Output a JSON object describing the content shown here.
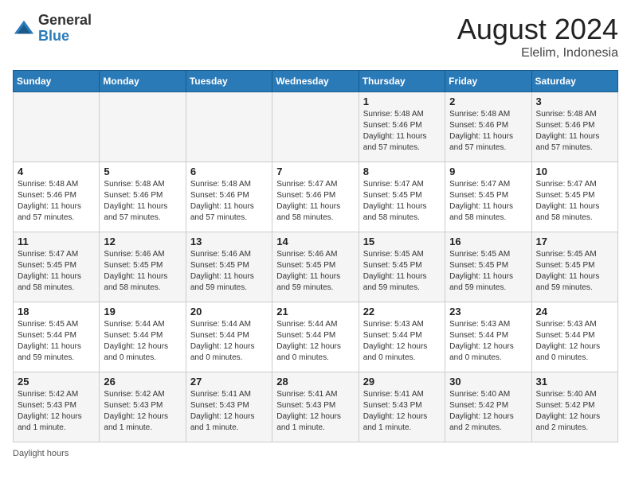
{
  "header": {
    "logo_general": "General",
    "logo_blue": "Blue",
    "month_year": "August 2024",
    "location": "Elelim, Indonesia"
  },
  "days_of_week": [
    "Sunday",
    "Monday",
    "Tuesday",
    "Wednesday",
    "Thursday",
    "Friday",
    "Saturday"
  ],
  "weeks": [
    [
      {
        "day": "",
        "info": ""
      },
      {
        "day": "",
        "info": ""
      },
      {
        "day": "",
        "info": ""
      },
      {
        "day": "",
        "info": ""
      },
      {
        "day": "1",
        "info": "Sunrise: 5:48 AM\nSunset: 5:46 PM\nDaylight: 11 hours\nand 57 minutes."
      },
      {
        "day": "2",
        "info": "Sunrise: 5:48 AM\nSunset: 5:46 PM\nDaylight: 11 hours\nand 57 minutes."
      },
      {
        "day": "3",
        "info": "Sunrise: 5:48 AM\nSunset: 5:46 PM\nDaylight: 11 hours\nand 57 minutes."
      }
    ],
    [
      {
        "day": "4",
        "info": "Sunrise: 5:48 AM\nSunset: 5:46 PM\nDaylight: 11 hours\nand 57 minutes."
      },
      {
        "day": "5",
        "info": "Sunrise: 5:48 AM\nSunset: 5:46 PM\nDaylight: 11 hours\nand 57 minutes."
      },
      {
        "day": "6",
        "info": "Sunrise: 5:48 AM\nSunset: 5:46 PM\nDaylight: 11 hours\nand 57 minutes."
      },
      {
        "day": "7",
        "info": "Sunrise: 5:47 AM\nSunset: 5:46 PM\nDaylight: 11 hours\nand 58 minutes."
      },
      {
        "day": "8",
        "info": "Sunrise: 5:47 AM\nSunset: 5:45 PM\nDaylight: 11 hours\nand 58 minutes."
      },
      {
        "day": "9",
        "info": "Sunrise: 5:47 AM\nSunset: 5:45 PM\nDaylight: 11 hours\nand 58 minutes."
      },
      {
        "day": "10",
        "info": "Sunrise: 5:47 AM\nSunset: 5:45 PM\nDaylight: 11 hours\nand 58 minutes."
      }
    ],
    [
      {
        "day": "11",
        "info": "Sunrise: 5:47 AM\nSunset: 5:45 PM\nDaylight: 11 hours\nand 58 minutes."
      },
      {
        "day": "12",
        "info": "Sunrise: 5:46 AM\nSunset: 5:45 PM\nDaylight: 11 hours\nand 58 minutes."
      },
      {
        "day": "13",
        "info": "Sunrise: 5:46 AM\nSunset: 5:45 PM\nDaylight: 11 hours\nand 59 minutes."
      },
      {
        "day": "14",
        "info": "Sunrise: 5:46 AM\nSunset: 5:45 PM\nDaylight: 11 hours\nand 59 minutes."
      },
      {
        "day": "15",
        "info": "Sunrise: 5:45 AM\nSunset: 5:45 PM\nDaylight: 11 hours\nand 59 minutes."
      },
      {
        "day": "16",
        "info": "Sunrise: 5:45 AM\nSunset: 5:45 PM\nDaylight: 11 hours\nand 59 minutes."
      },
      {
        "day": "17",
        "info": "Sunrise: 5:45 AM\nSunset: 5:45 PM\nDaylight: 11 hours\nand 59 minutes."
      }
    ],
    [
      {
        "day": "18",
        "info": "Sunrise: 5:45 AM\nSunset: 5:44 PM\nDaylight: 11 hours\nand 59 minutes."
      },
      {
        "day": "19",
        "info": "Sunrise: 5:44 AM\nSunset: 5:44 PM\nDaylight: 12 hours\nand 0 minutes."
      },
      {
        "day": "20",
        "info": "Sunrise: 5:44 AM\nSunset: 5:44 PM\nDaylight: 12 hours\nand 0 minutes."
      },
      {
        "day": "21",
        "info": "Sunrise: 5:44 AM\nSunset: 5:44 PM\nDaylight: 12 hours\nand 0 minutes."
      },
      {
        "day": "22",
        "info": "Sunrise: 5:43 AM\nSunset: 5:44 PM\nDaylight: 12 hours\nand 0 minutes."
      },
      {
        "day": "23",
        "info": "Sunrise: 5:43 AM\nSunset: 5:44 PM\nDaylight: 12 hours\nand 0 minutes."
      },
      {
        "day": "24",
        "info": "Sunrise: 5:43 AM\nSunset: 5:44 PM\nDaylight: 12 hours\nand 0 minutes."
      }
    ],
    [
      {
        "day": "25",
        "info": "Sunrise: 5:42 AM\nSunset: 5:43 PM\nDaylight: 12 hours\nand 1 minute."
      },
      {
        "day": "26",
        "info": "Sunrise: 5:42 AM\nSunset: 5:43 PM\nDaylight: 12 hours\nand 1 minute."
      },
      {
        "day": "27",
        "info": "Sunrise: 5:41 AM\nSunset: 5:43 PM\nDaylight: 12 hours\nand 1 minute."
      },
      {
        "day": "28",
        "info": "Sunrise: 5:41 AM\nSunset: 5:43 PM\nDaylight: 12 hours\nand 1 minute."
      },
      {
        "day": "29",
        "info": "Sunrise: 5:41 AM\nSunset: 5:43 PM\nDaylight: 12 hours\nand 1 minute."
      },
      {
        "day": "30",
        "info": "Sunrise: 5:40 AM\nSunset: 5:42 PM\nDaylight: 12 hours\nand 2 minutes."
      },
      {
        "day": "31",
        "info": "Sunrise: 5:40 AM\nSunset: 5:42 PM\nDaylight: 12 hours\nand 2 minutes."
      }
    ]
  ],
  "footer": {
    "daylight_label": "Daylight hours"
  }
}
